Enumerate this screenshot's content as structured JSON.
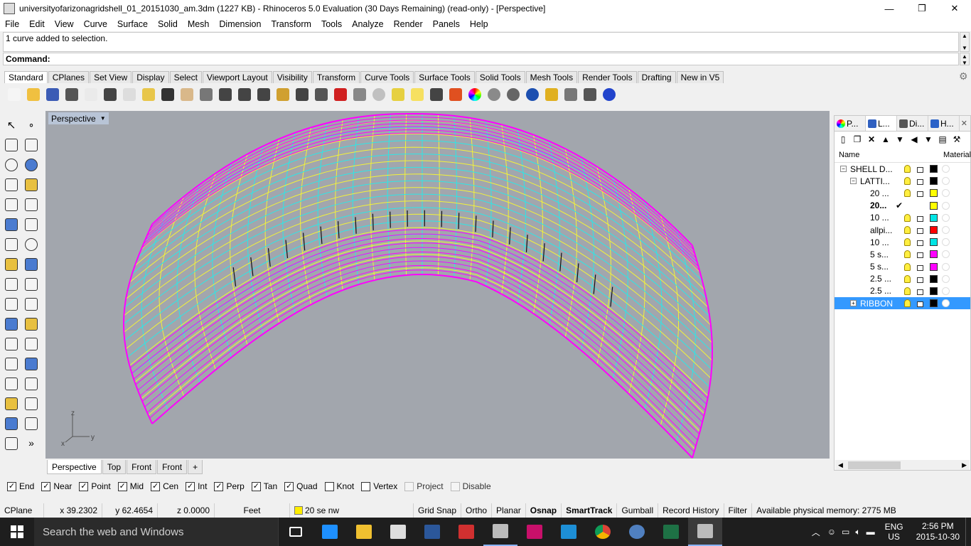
{
  "window": {
    "title": "universityofarizonagridshell_01_20151030_am.3dm (1227 KB) - Rhinoceros 5.0 Evaluation (30 Days Remaining) (read-only) - [Perspective]",
    "minimize": "—",
    "restore": "❐",
    "close": "✕"
  },
  "menu": [
    "File",
    "Edit",
    "View",
    "Curve",
    "Surface",
    "Solid",
    "Mesh",
    "Dimension",
    "Transform",
    "Tools",
    "Analyze",
    "Render",
    "Panels",
    "Help"
  ],
  "command": {
    "history": "1 curve added to selection.",
    "prompt": "Command:"
  },
  "toolbar_tabs": [
    "Standard",
    "CPlanes",
    "Set View",
    "Display",
    "Select",
    "Viewport Layout",
    "Visibility",
    "Transform",
    "Curve Tools",
    "Surface Tools",
    "Solid Tools",
    "Mesh Tools",
    "Render Tools",
    "Drafting",
    "New in V5"
  ],
  "toolbar_icons": [
    "new-file-icon",
    "open-folder-icon",
    "save-icon",
    "print-icon",
    "import-icon",
    "cut-icon",
    "copy-icon",
    "paste-icon",
    "undo-icon",
    "pan-hand-icon",
    "rotate-view-icon",
    "zoom-icon",
    "zoom-window-icon",
    "zoom-extents-icon",
    "zoom-selected-icon",
    "four-viewports-icon",
    "grid-icon",
    "car-icon",
    "shade-icon",
    "target-icon",
    "light-icon",
    "bulb-icon",
    "lock-icon",
    "layer-icon",
    "color-wheel-icon",
    "sphere-gray-icon",
    "sphere-shaded-icon",
    "sphere-blue-icon",
    "filter-icon",
    "settings-icon",
    "grips-icon",
    "help-icon"
  ],
  "viewport": {
    "label": "Perspective",
    "axes": {
      "z": "z",
      "y": "y",
      "x": "x"
    }
  },
  "viewport_tabs": [
    "Perspective",
    "Top",
    "Front",
    "Front",
    "+"
  ],
  "panel": {
    "tabs": [
      {
        "label": "P...",
        "icon": "properties-icon"
      },
      {
        "label": "L...",
        "icon": "layers-icon"
      },
      {
        "label": "Di...",
        "icon": "display-icon"
      },
      {
        "label": "H...",
        "icon": "help-panel-icon"
      }
    ],
    "close": "✕",
    "columns": {
      "name": "Name",
      "material": "Material"
    },
    "layers": [
      {
        "name": "SHELL D...",
        "depth": 0,
        "expander": "−",
        "color": "#000000",
        "current": false,
        "visible": true
      },
      {
        "name": "LATTI...",
        "depth": 1,
        "expander": "−",
        "color": "#000000",
        "current": false,
        "visible": true
      },
      {
        "name": "20 ...",
        "depth": 2,
        "expander": "",
        "color": "#ffff00",
        "current": false,
        "visible": true
      },
      {
        "name": "20...",
        "depth": 2,
        "expander": "",
        "color": "#ffff00",
        "current": true,
        "visible": false
      },
      {
        "name": "10 ...",
        "depth": 2,
        "expander": "",
        "color": "#00e5e5",
        "current": false,
        "visible": true
      },
      {
        "name": "allpi...",
        "depth": 2,
        "expander": "",
        "color": "#ff0000",
        "current": false,
        "visible": true
      },
      {
        "name": "10 ...",
        "depth": 2,
        "expander": "",
        "color": "#00e5e5",
        "current": false,
        "visible": true
      },
      {
        "name": "5 s...",
        "depth": 2,
        "expander": "",
        "color": "#ff00ff",
        "current": false,
        "visible": true
      },
      {
        "name": "5 s...",
        "depth": 2,
        "expander": "",
        "color": "#ff00ff",
        "current": false,
        "visible": true
      },
      {
        "name": "2.5 ...",
        "depth": 2,
        "expander": "",
        "color": "#000000",
        "current": false,
        "visible": true
      },
      {
        "name": "2.5 ...",
        "depth": 2,
        "expander": "",
        "color": "#000000",
        "current": false,
        "visible": true
      },
      {
        "name": "RIBBON",
        "depth": 1,
        "expander": "+",
        "color": "#000000",
        "current": false,
        "visible": true,
        "selected": true
      }
    ],
    "current_mark": "✔"
  },
  "osnaps": [
    {
      "label": "End",
      "checked": true,
      "enabled": true
    },
    {
      "label": "Near",
      "checked": true,
      "enabled": true
    },
    {
      "label": "Point",
      "checked": true,
      "enabled": true
    },
    {
      "label": "Mid",
      "checked": true,
      "enabled": true
    },
    {
      "label": "Cen",
      "checked": true,
      "enabled": true
    },
    {
      "label": "Int",
      "checked": true,
      "enabled": true
    },
    {
      "label": "Perp",
      "checked": true,
      "enabled": true
    },
    {
      "label": "Tan",
      "checked": true,
      "enabled": true
    },
    {
      "label": "Quad",
      "checked": true,
      "enabled": true
    },
    {
      "label": "Knot",
      "checked": false,
      "enabled": true
    },
    {
      "label": "Vertex",
      "checked": false,
      "enabled": true
    },
    {
      "label": "Project",
      "checked": false,
      "enabled": false
    },
    {
      "label": "Disable",
      "checked": false,
      "enabled": false
    }
  ],
  "status": {
    "cplane": "CPlane",
    "x": "x 39.2302",
    "y": "y 62.4654",
    "z": "z 0.0000",
    "units": "Feet",
    "layer": "20 se nw",
    "layer_color": "#ffee00",
    "grid_snap": "Grid Snap",
    "ortho": "Ortho",
    "planar": "Planar",
    "osnap": "Osnap",
    "smarttrack": "SmartTrack",
    "gumball": "Gumball",
    "record_history": "Record History",
    "filter": "Filter",
    "memory": "Available physical memory: 2775 MB"
  },
  "taskbar": {
    "search_placeholder": "Search the web and Windows",
    "apps": [
      "task-view-icon",
      "edge-icon",
      "file-explorer-icon",
      "store-icon",
      "word-icon",
      "app-red-icon",
      "rhino-icon",
      "indesign-icon",
      "photoshop-icon",
      "chrome-icon",
      "magnifier-icon",
      "excel-icon",
      "rhino-active-icon"
    ],
    "lang": "ENG",
    "region": "US",
    "time": "2:56 PM",
    "date": "2015-10-30"
  },
  "colors": {
    "viewport_bg": "#a2a6ad",
    "grid_yellow": "#f2f23a",
    "grid_cyan": "#2ee6e6",
    "edge_magenta": "#ff00ff",
    "selection": "#3399ff"
  }
}
